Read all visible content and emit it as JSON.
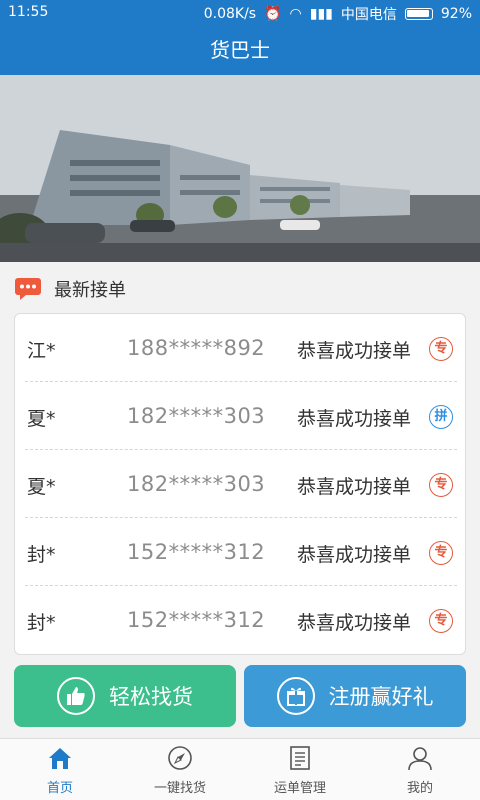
{
  "status_bar": {
    "time": "11:55",
    "network_speed": "0.08K/s",
    "carrier": "中国电信",
    "battery": "92%"
  },
  "header": {
    "title": "货巴士"
  },
  "section": {
    "title": "最新接单"
  },
  "orders": [
    {
      "name": "江*",
      "phone": "188*****892",
      "status": "恭喜成功接单",
      "badge": "专",
      "badge_color": "#e55a3c"
    },
    {
      "name": "夏*",
      "phone": "182*****303",
      "status": "恭喜成功接单",
      "badge": "拼",
      "badge_color": "#2f8fe0"
    },
    {
      "name": "夏*",
      "phone": "182*****303",
      "status": "恭喜成功接单",
      "badge": "专",
      "badge_color": "#e55a3c"
    },
    {
      "name": "封*",
      "phone": "152*****312",
      "status": "恭喜成功接单",
      "badge": "专",
      "badge_color": "#e55a3c"
    },
    {
      "name": "封*",
      "phone": "152*****312",
      "status": "恭喜成功接单",
      "badge": "专",
      "badge_color": "#e55a3c"
    }
  ],
  "actions": {
    "find_goods": "轻松找货",
    "register": "注册赢好礼"
  },
  "tabs": [
    {
      "label": "首页",
      "icon": "home-icon",
      "active": true
    },
    {
      "label": "一键找货",
      "icon": "compass-icon",
      "active": false
    },
    {
      "label": "运单管理",
      "icon": "document-icon",
      "active": false
    },
    {
      "label": "我的",
      "icon": "user-icon",
      "active": false
    }
  ],
  "colors": {
    "primary": "#1f7bc8",
    "green_button": "#3cbf8c",
    "blue_button": "#3c9ad6",
    "badge_red": "#e55a3c",
    "badge_blue": "#2f8fe0"
  }
}
